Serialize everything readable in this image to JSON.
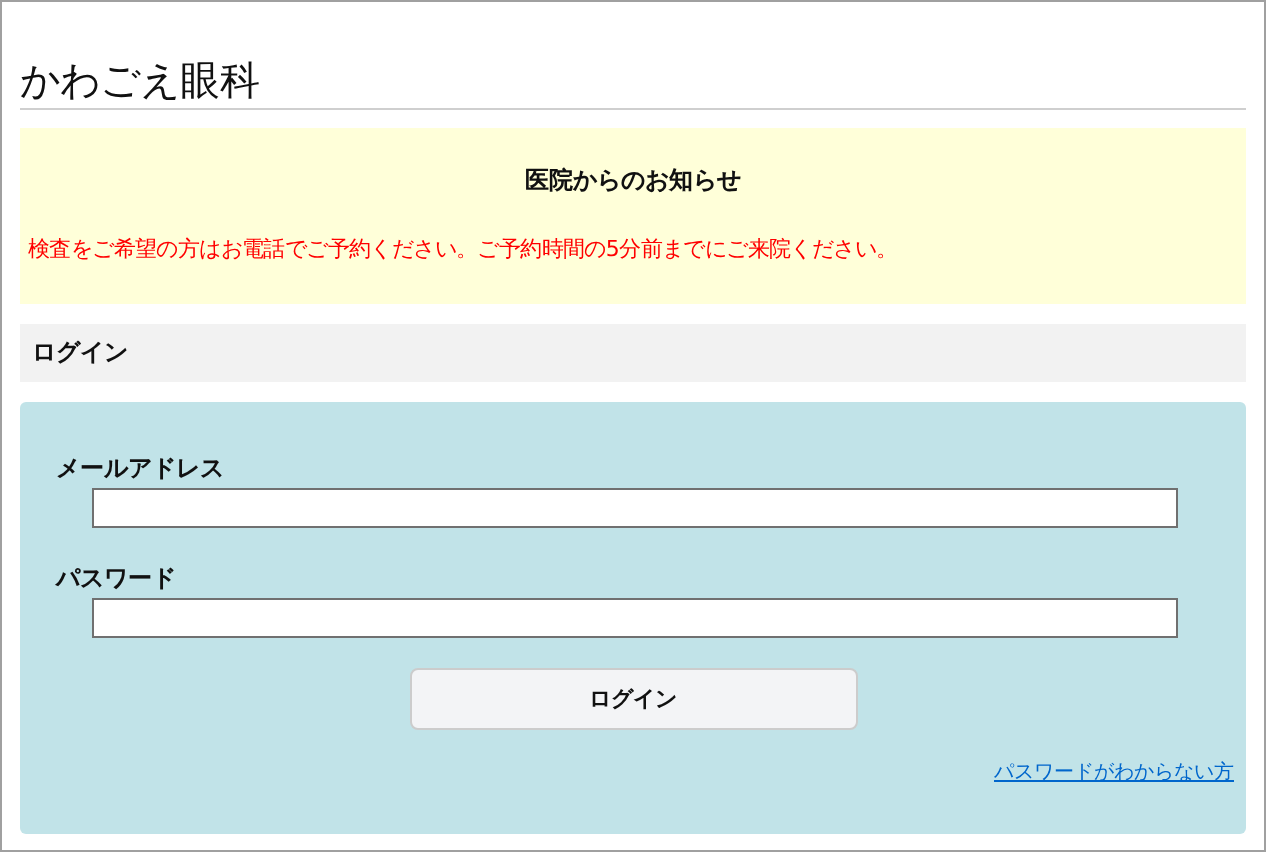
{
  "clinic_name": "かわごえ眼科",
  "notice": {
    "title": "医院からのお知らせ",
    "message": "検査をご希望の方はお電話でご予約ください。ご予約時間の5分前までにご来院ください。"
  },
  "section_title": "ログイン",
  "login_form": {
    "fields": [
      {
        "label": "メールアドレス"
      },
      {
        "label": "パスワード"
      }
    ],
    "submit": "ログイン",
    "forgot_link": "パスワードがわからない方"
  }
}
